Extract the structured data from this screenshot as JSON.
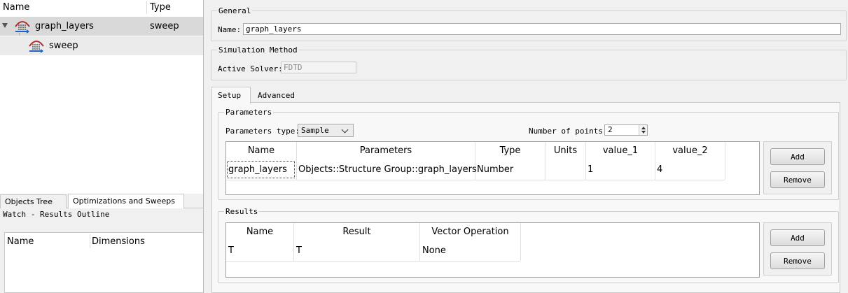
{
  "tree": {
    "columns": {
      "name": "Name",
      "type": "Type"
    },
    "items": [
      {
        "name": "graph_layers",
        "type": "sweep"
      },
      {
        "name": "sweep",
        "type": ""
      }
    ]
  },
  "bottom_tabs": [
    "Objects Tree",
    "Optimizations and Sweeps"
  ],
  "watch": {
    "title": "Watch - Results Outline",
    "columns": {
      "name": "Name",
      "dimensions": "Dimensions"
    }
  },
  "general": {
    "title": "General",
    "name_label": "Name:",
    "name_value": "graph_layers"
  },
  "simulation": {
    "title": "Simulation Method",
    "solver_label": "Active Solver:",
    "solver_value": "FDTD"
  },
  "tabs": [
    "Setup",
    "Advanced"
  ],
  "parameters": {
    "title": "Parameters",
    "type_label": "Parameters type:",
    "type_value": "Sample",
    "points_label": "Number of points:",
    "points_value": "2",
    "columns": [
      "Name",
      "Parameters",
      "Type",
      "Units",
      "value_1",
      "value_2"
    ],
    "rows": [
      {
        "name": "graph_layers",
        "parameters": "Objects::Structure Group::graph_layers",
        "type": "Number",
        "units": "",
        "value_1": "1",
        "value_2": "4"
      }
    ],
    "add_label": "Add",
    "remove_label": "Remove"
  },
  "results": {
    "title": "Results",
    "columns": [
      "Name",
      "Result",
      "Vector Operation"
    ],
    "rows": [
      {
        "name": "T",
        "result": "T",
        "vector_operation": "None"
      }
    ],
    "add_label": "Add",
    "remove_label": "Remove"
  },
  "colors": {
    "selection": "#d9d9d9",
    "panel": "#f0f0f0",
    "icon_red": "#b03030",
    "icon_blue": "#2060c0"
  }
}
